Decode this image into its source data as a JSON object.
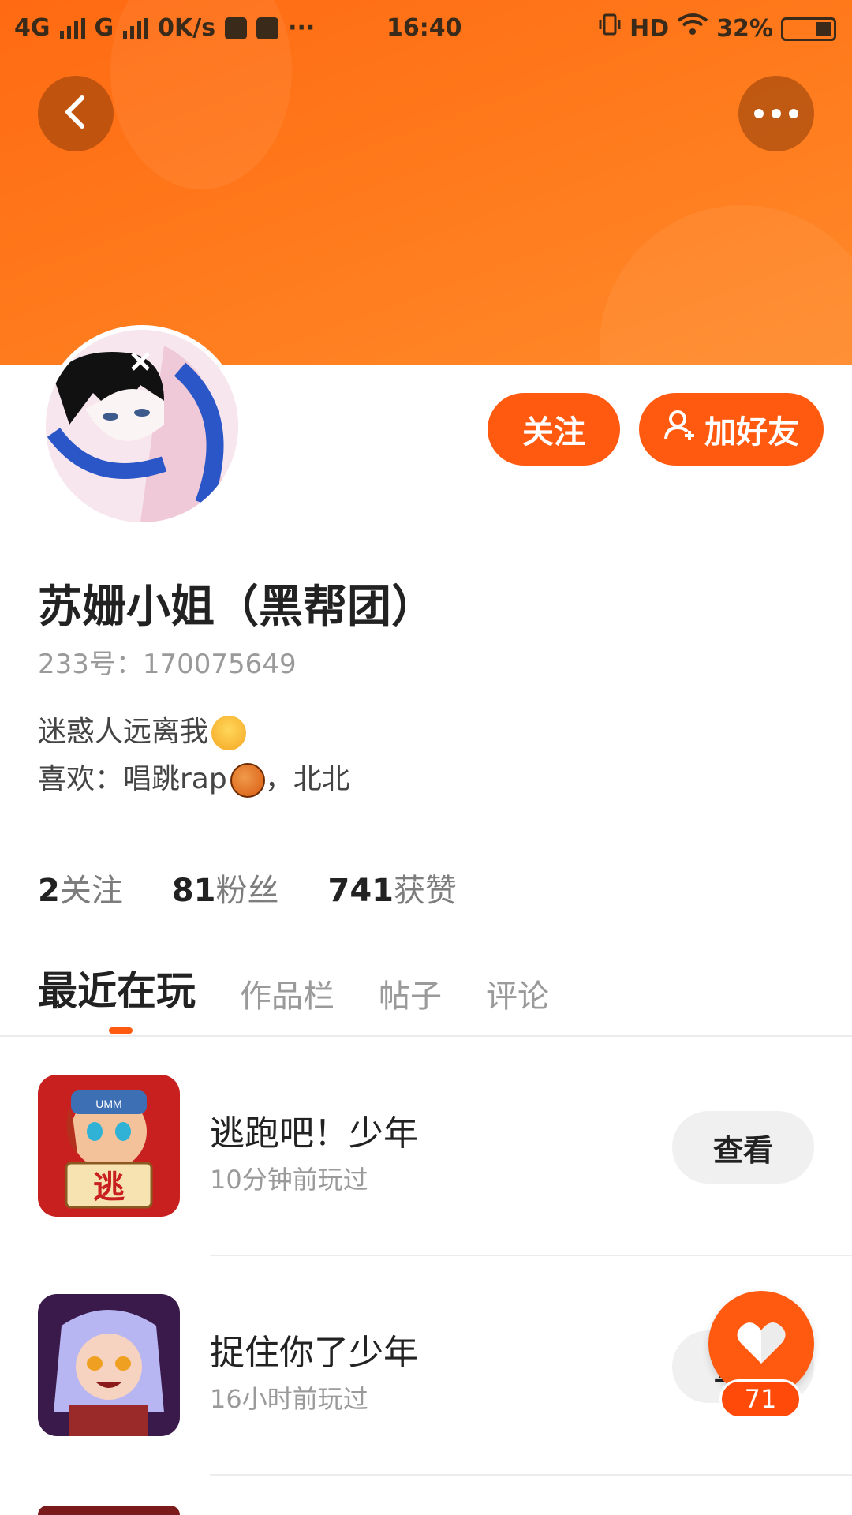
{
  "status_bar": {
    "network1": "4G",
    "network2": "G",
    "speed": "0K/s",
    "more": "···",
    "time": "16:40",
    "hd": "HD",
    "battery": "32%"
  },
  "header": {
    "back_icon": "chevron-left-icon",
    "more_icon": "more-dots-icon"
  },
  "profile": {
    "follow_label": "关注",
    "add_friend_label": "加好友",
    "name": "苏姗小姐（黑帮团）",
    "id_text": "233号：170075649",
    "bio_line1": "迷惑人远离我",
    "bio_line2_a": "喜欢：唱跳rap",
    "bio_line2_b": "，北北"
  },
  "stats": [
    {
      "value": "2",
      "label": "关注"
    },
    {
      "value": "81",
      "label": "粉丝"
    },
    {
      "value": "741",
      "label": "获赞"
    }
  ],
  "tabs": [
    {
      "label": "最近在玩",
      "active": true
    },
    {
      "label": "作品栏",
      "active": false
    },
    {
      "label": "帖子",
      "active": false
    },
    {
      "label": "评论",
      "active": false
    }
  ],
  "games": [
    {
      "title": "逃跑吧！少年",
      "sub": "10分钟前玩过",
      "button": "查看",
      "badge_text": "逃",
      "cap_text": "UMM"
    },
    {
      "title": "捉住你了少年",
      "sub": "16小时前玩过",
      "button": "查看"
    }
  ],
  "fab": {
    "icon": "heart-icon",
    "count": "71"
  },
  "colors": {
    "accent": "#ff5a10",
    "banner": "#ff7a1c"
  }
}
